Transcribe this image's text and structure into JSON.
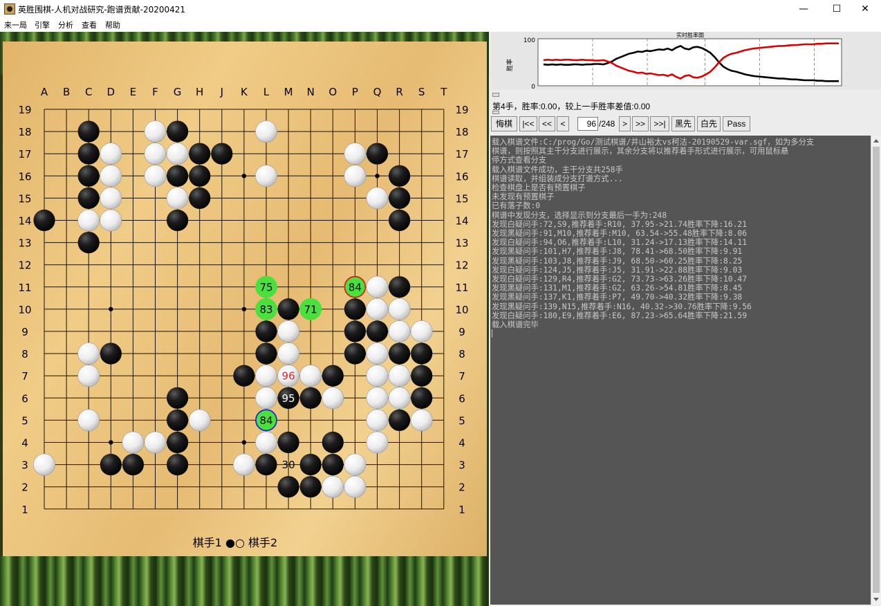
{
  "window": {
    "title": "英胜围棋-人机对战研究-跑谱贡献-20200421",
    "controls": {
      "minimize": "—",
      "maximize": "☐",
      "close": "✕"
    }
  },
  "menu": [
    "来一局",
    "引擎",
    "分析",
    "查看",
    "帮助"
  ],
  "board": {
    "columns": [
      "A",
      "B",
      "C",
      "D",
      "E",
      "F",
      "G",
      "H",
      "J",
      "K",
      "L",
      "M",
      "N",
      "O",
      "P",
      "Q",
      "R",
      "S",
      "T"
    ],
    "rows": [
      "19",
      "18",
      "17",
      "16",
      "15",
      "14",
      "13",
      "12",
      "11",
      "10",
      "9",
      "8",
      "7",
      "6",
      "5",
      "4",
      "3",
      "2",
      "1"
    ],
    "hoshi": [
      "D16",
      "K16",
      "Q16",
      "D10",
      "K10",
      "Q10",
      "D4",
      "K4",
      "Q4"
    ],
    "black_stones": [
      "C18",
      "G18",
      "C17",
      "H17",
      "J17",
      "Q17",
      "C16",
      "G16",
      "H16",
      "R16",
      "C15",
      "H15",
      "R15",
      "A14",
      "G14",
      "R14",
      "C13",
      "R11",
      "M10",
      "P10",
      "L9",
      "P9",
      "Q9",
      "D8",
      "L8",
      "P8",
      "R8",
      "S8",
      "K7",
      "O7",
      "S7",
      "M6",
      "N6",
      "S6",
      "G6",
      "G5",
      "R5",
      "G4",
      "M4",
      "O4",
      "D3",
      "E3",
      "G3",
      "L3",
      "N3",
      "O3",
      "M2",
      "N2"
    ],
    "white_stones": [
      "F18",
      "L18",
      "D17",
      "F17",
      "G17",
      "P17",
      "D16",
      "F16",
      "L16",
      "P16",
      "D15",
      "G15",
      "Q15",
      "C14",
      "D14",
      "Q11",
      "Q10",
      "R10",
      "M9",
      "R9",
      "S9",
      "C8",
      "M8",
      "Q8",
      "C7",
      "L7",
      "N7",
      "Q7",
      "R7",
      "L6",
      "O6",
      "Q6",
      "R6",
      "C5",
      "H5",
      "Q5",
      "S5",
      "E4",
      "F4",
      "L4",
      "Q4",
      "A3",
      "K3",
      "P3",
      "O2",
      "P2"
    ],
    "numbered_stones": [
      {
        "point": "M7",
        "label": "96",
        "kind": "white",
        "text_color": "#e0202a"
      },
      {
        "point": "M6",
        "label": "95",
        "kind": "black",
        "text_color": "#ffffff"
      }
    ],
    "marks": [
      {
        "point": "L11",
        "label": "75",
        "fill": "#4be03c",
        "ring": "#4be03c"
      },
      {
        "point": "P11",
        "label": "84",
        "fill": "#4be03c",
        "ring": "#cc2a1a"
      },
      {
        "point": "L10",
        "label": "83",
        "fill": "#4be03c",
        "ring": "#4be03c"
      },
      {
        "point": "N10",
        "label": "71",
        "fill": "#4be03c",
        "ring": "#4be03c"
      },
      {
        "point": "L5",
        "label": "84",
        "fill": "#4be03c",
        "ring": "#1a2bd0"
      }
    ],
    "point_labels": [
      {
        "point": "M3",
        "label": "30"
      }
    ],
    "players": "棋手1 ●○ 棋手2"
  },
  "chart_data": {
    "type": "line",
    "title": "实时胜率图",
    "ylabel": "胜率",
    "yticks": [
      "100",
      "0"
    ],
    "ylim": [
      0,
      100
    ],
    "xlim": [
      0,
      248
    ],
    "grid": true,
    "series": [
      {
        "color": "#000000",
        "values": [
          45,
          44,
          45,
          44,
          45,
          44,
          44,
          45,
          45,
          44,
          45,
          45,
          46,
          46,
          45,
          48,
          52,
          58,
          62,
          66,
          70,
          72,
          75,
          74,
          77,
          76,
          78,
          80,
          79,
          82,
          78,
          84,
          88,
          82,
          80,
          85,
          86,
          83,
          78,
          72,
          62,
          50,
          40,
          34,
          30,
          28,
          25,
          22,
          20,
          18,
          17,
          16,
          15,
          14,
          13,
          12,
          12,
          11,
          10,
          10,
          9,
          8,
          8,
          8,
          7,
          7,
          6,
          6,
          6,
          6
        ]
      },
      {
        "color": "#e00000",
        "values": [
          55,
          56,
          55,
          56,
          55,
          56,
          56,
          55,
          55,
          56,
          55,
          55,
          54,
          54,
          55,
          52,
          48,
          42,
          38,
          34,
          30,
          28,
          25,
          26,
          23,
          24,
          22,
          20,
          21,
          18,
          22,
          16,
          12,
          18,
          20,
          15,
          14,
          17,
          22,
          28,
          38,
          50,
          60,
          66,
          70,
          72,
          75,
          78,
          80,
          82,
          83,
          84,
          85,
          86,
          87,
          88,
          88,
          89,
          90,
          90,
          91,
          92,
          92,
          92,
          93,
          93,
          94,
          94,
          94,
          94
        ]
      }
    ]
  },
  "status": "第4手，胜率:0.00，较上一手胜率差值:0.00",
  "toolbar": {
    "buttons": [
      "悔棋",
      "|<<",
      "<<",
      "<",
      ">",
      ">>",
      ">>|",
      "黑先",
      "白先",
      "Pass"
    ],
    "move_value": "96",
    "move_total": "/248"
  },
  "log_lines": [
    "载入棋谱文件:C:/prog/Go/测试棋谱/井山裕太vs柯洁-20190529-var.sgf，如为多分支",
    "棋谱，则按照其主干分支进行展示，其余分支将以推荐着手形式进行展示，可用鼠标悬",
    "停方式查看分支",
    "载入棋谱文件成功，主干分支共258手",
    "棋谱读取，并组装成分支打谱方式...",
    "检查棋盘上是否有预置棋子",
    "未发现有预置棋子",
    "已有落子数:0",
    "棋谱中发现分支，选择显示到分支最后一手为:248",
    "发现白疑问手:72,S9,推荐着手:R10, 37.95->21.74胜率下降:16.21",
    "发现黑疑问手:91,M10,推荐着手:M10, 63.54->55.48胜率下降:8.06",
    "发现白疑问手:94,O6,推荐着手:L10, 31.24->17.13胜率下降:14.11",
    "发现黑疑问手:101,H7,推荐着手:J8, 78.41->68.50胜率下降:9.91",
    "发现黑疑问手:103,J8,推荐着手:J9, 68.50->60.25胜率下降:8.25",
    "发现白疑问手:124,J5,推荐着手:J5, 31.91->22.88胜率下降:9.03",
    "发现白疑问手:129,R4,推荐着手:G2, 73.73->63.26胜率下降:10.47",
    "发现黑疑问手:131,M1,推荐着手:G2, 63.26->54.81胜率下降:8.45",
    "发现黑疑问手:137,K1,推荐着手:P7, 49.70->40.32胜率下降:9.38",
    "发现黑疑问手:139,N15,推荐着手:N16, 40.32->30.76胜率下降:9.56",
    "发现白疑问手:180,E9,推荐着手:E6, 87.23->65.64胜率下降:21.59",
    "载入棋谱完毕"
  ]
}
